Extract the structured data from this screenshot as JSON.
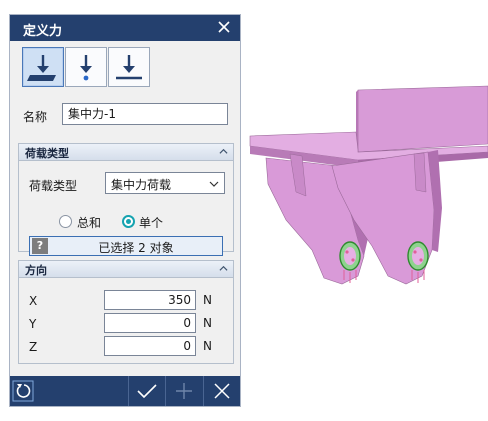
{
  "dialog": {
    "title": "定义力",
    "close_icon": "close-icon"
  },
  "mode_buttons": [
    {
      "icon": "surface-force-icon",
      "active": true
    },
    {
      "icon": "point-force-icon",
      "active": false
    },
    {
      "icon": "line-force-icon",
      "active": false
    }
  ],
  "name": {
    "label": "名称",
    "value": "集中力-1"
  },
  "load_type": {
    "header": "荷载类型",
    "field_label": "荷载类型",
    "selected": "集中力荷载",
    "radio_total": "总和",
    "radio_single": "单个",
    "selected_radio": "单个",
    "selection_label": "已选择 2 对象"
  },
  "direction": {
    "header": "方向",
    "rows": [
      {
        "axis": "X",
        "value": "350",
        "unit": "N"
      },
      {
        "axis": "Y",
        "value": "0",
        "unit": "N"
      },
      {
        "axis": "Z",
        "value": "0",
        "unit": "N"
      }
    ]
  },
  "footer": {
    "reset_icon": "reset-icon",
    "ok_icon": "check-icon",
    "add_icon": "plus-icon",
    "cancel_icon": "close-icon"
  },
  "colors": {
    "title_bar": "#24406e",
    "model_face": "#d99ad8",
    "accent": "#16a3b0"
  }
}
